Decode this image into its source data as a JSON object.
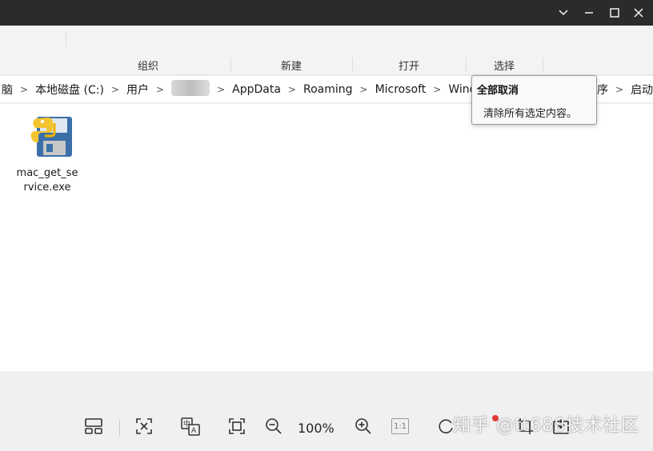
{
  "window": {
    "controls": [
      "chevron-down-icon",
      "minimize-icon",
      "maximize-icon",
      "close-icon"
    ]
  },
  "ribbon": {
    "groups": [
      "组织",
      "新建",
      "打开",
      "选择"
    ]
  },
  "address": {
    "crumbs": [
      "脑",
      "本地磁盘 (C:)",
      "用户",
      "",
      "AppData",
      "Roaming",
      "Microsoft",
      "Window",
      "序",
      "启动"
    ]
  },
  "files": [
    {
      "name": "mac_get_service.exe",
      "icon": "python-installer-icon"
    }
  ],
  "tooltip": {
    "title": "全部取消",
    "description": "清除所有选定内容。"
  },
  "viewer": {
    "zoom": "100%",
    "actual_size_label": "1:1"
  },
  "watermark": "知乎 @tt688技术社区",
  "colors": {
    "titlebar": "#2b2b2b",
    "ribbon": "#f3f3f3",
    "content": "#ffffff",
    "viewer": "#f0f0f0"
  }
}
